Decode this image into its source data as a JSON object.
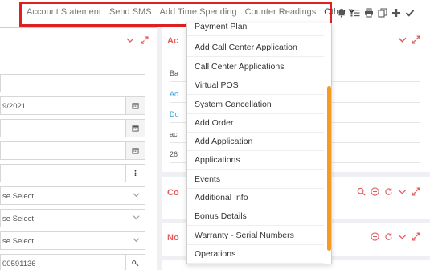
{
  "topbar": {
    "links": [
      "Account Statement",
      "Send SMS",
      "Add Time Spending",
      "Counter Readings"
    ],
    "other_label": "Other",
    "tools": [
      "bell-icon",
      "list-icon",
      "print-icon",
      "copy-icon",
      "plus-icon",
      "check-icon"
    ]
  },
  "left_panel": {
    "date_value": "9/2021",
    "select_placeholder": "se Select",
    "code_value": "00591136"
  },
  "right_panels": [
    {
      "title": "Ac",
      "rows": [
        "Ba",
        "Ac",
        "Do",
        "ac",
        "26"
      ]
    },
    {
      "title": "Co"
    },
    {
      "title": "No"
    }
  ],
  "dropdown": {
    "items": [
      "Payment Plan",
      "Add Call Center Application",
      "Call Center Applications",
      "Virtual POS",
      "System Cancellation",
      "Add Order",
      "Add Application",
      "Applications",
      "Events",
      "Additional Info",
      "Bonus Details",
      "Warranty - Serial Numbers",
      "Operations"
    ]
  },
  "colors": {
    "accent": "#e35d5d",
    "highlight": "#e02020",
    "scrollbar": "#f59a23",
    "link": "#3aa0d8"
  }
}
